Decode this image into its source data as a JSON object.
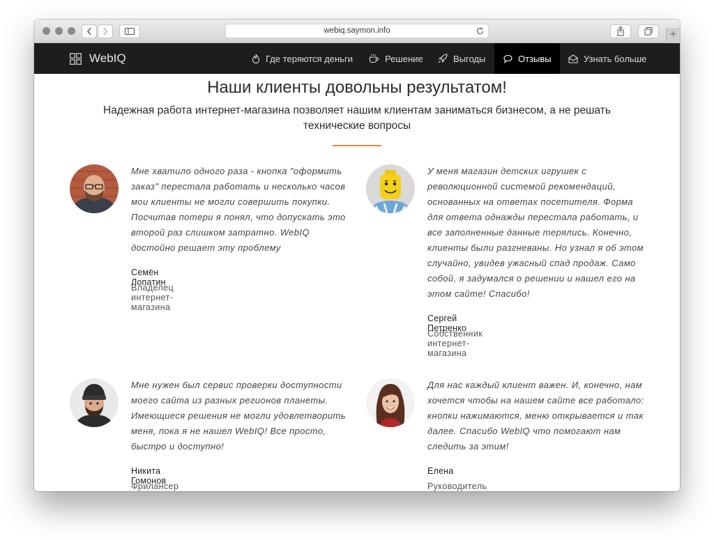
{
  "browser": {
    "url": "webiq.saymon.info"
  },
  "site": {
    "brand": "WebIQ",
    "nav": [
      {
        "label": "Где теряются деньги",
        "icon": "fire-icon"
      },
      {
        "label": "Решение",
        "icon": "coffee-icon"
      },
      {
        "label": "Выгоды",
        "icon": "rocket-icon"
      },
      {
        "label": "Отзывы",
        "icon": "speech-bubble-icon",
        "active": true
      },
      {
        "label": "Узнать больше",
        "icon": "envelope-icon"
      }
    ]
  },
  "reviews": {
    "title": "Наши клиенты довольны результатом!",
    "subtitle": "Надежная работа интернет-магазина позволяет нашим клиентам заниматься бизнесом, а не решать технические вопросы",
    "items": [
      {
        "quote": "Мне хватило одного раза - кнопка \"оформить заказ\" перестала работать и несколько часов мои клиенты не могли совершить покупки. Посчитав потери я понял, что допускать это второй раз слишком затратно. WebIQ достойно решает эту проблему",
        "name": "Семён Лопатин",
        "role": "Владелец интернет-магазина"
      },
      {
        "quote": "У меня магазин детских игрушек с революционной системой рекомендаций, основанных на ответах посетителя. Форма для ответа однажды перестала работать, и все заполненные данные терялись. Конечно, клиенты были разгневаны. Но узнал я об этом случайно, увидев ужасный спад продаж. Само собой, я задумался о решении и нашел его на этом сайте! Спасибо!",
        "name": "Сергей Петренко",
        "role": "Собственник интернет-магазина"
      },
      {
        "quote": "Мне нужен был сервис проверки доступности моего сайта из разных регионов планеты. Имеющиеся решения не могли удовлетворить меня, пока я не нашел WebIQ! Все просто, быстро и доступно!",
        "name": "Никита Гомонов",
        "role": "Фрилансер"
      },
      {
        "quote": "Для нас каждый клиент важен. И, конечно, нам хочется чтобы на нашем сайте все работало: кнопки нажимаются, меню открывается и так далее. Спасибо WebIQ что помогают нам следить за этим!",
        "name": "Елена",
        "role": "Руководитель отдела продаж"
      }
    ]
  },
  "colors": {
    "navbar": "#1d1d1d",
    "nav_active": "#000000",
    "accent": "#f0843c"
  }
}
